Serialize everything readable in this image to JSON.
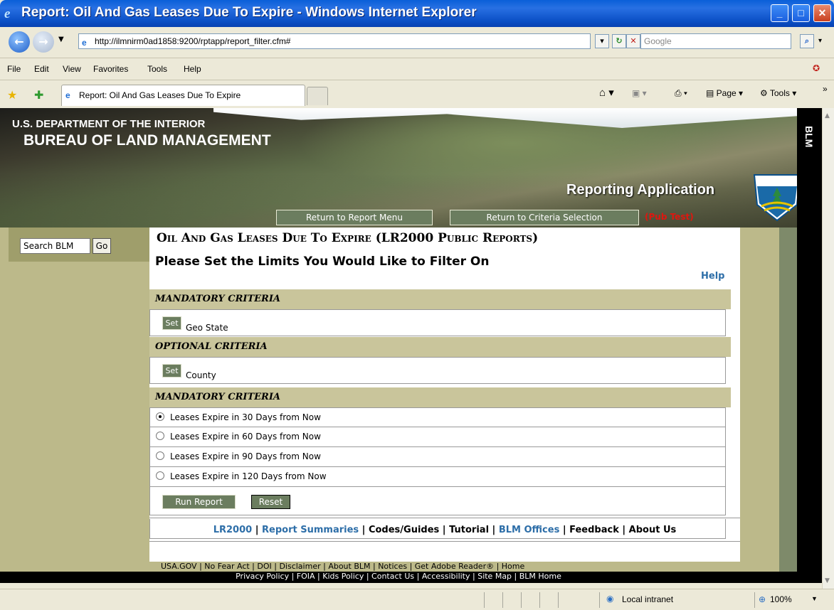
{
  "window": {
    "title": "Report: Oil And Gas Leases Due To Expire - Windows Internet Explorer",
    "address": "http://ilmnirm0ad1858:9200/rptapp/report_filter.cfm#",
    "search_placeholder": "Google"
  },
  "menu": [
    "File",
    "Edit",
    "View",
    "Favorites",
    "Tools",
    "Help"
  ],
  "tabbar": {
    "tab_label": "Report: Oil And Gas Leases Due To Expire",
    "page_label": "Page",
    "tools_label": "Tools"
  },
  "banner": {
    "dept": "U.S. DEPARTMENT OF THE INTERIOR",
    "bureau": "BUREAU OF LAND MANAGEMENT",
    "app": "Reporting Application",
    "side": "BLM",
    "nav_report_menu": "Return to Report Menu",
    "nav_criteria": "Return to Criteria Selection",
    "pub_test": "(Pub Test)"
  },
  "sidebar": {
    "search_value": "Search BLM",
    "go_label": "Go"
  },
  "report": {
    "title": "Oil And Gas Leases Due To Expire (LR2000 Public Reports)",
    "subtitle": "Please Set the Limits You Would Like to Filter On",
    "help": "Help",
    "section1": "MANDATORY CRITERIA",
    "set1_btn": "Set",
    "set1_label": "Geo State",
    "section2": "OPTIONAL CRITERIA",
    "set2_btn": "Set",
    "set2_label": "County",
    "section3": "MANDATORY CRITERIA",
    "options": [
      "Leases Expire in 30 Days from Now",
      "Leases Expire in 60 Days from Now",
      "Leases Expire in 90 Days from Now",
      "Leases Expire in 120 Days from Now"
    ],
    "selected_option": "Leases Expire in 30 Days from Now",
    "run_btn": "Run Report",
    "reset_btn": "Reset"
  },
  "footer_links": {
    "lr2000": "LR2000",
    "summaries": "Report Summaries",
    "codes": "Codes/Guides",
    "tutorial": "Tutorial",
    "offices": "BLM Offices",
    "feedback": "Feedback",
    "about": "About Us"
  },
  "bottom": {
    "line1": "USA.GOV  |  No Fear Act  |  DOI  |  Disclaimer  |  About BLM  |  Notices  |  Get Adobe Reader® | Home",
    "line2": "Privacy Policy  |  FOIA  |  Kids Policy  |  Contact Us  |  Accessibility  |  Site Map  |  BLM Home"
  },
  "status": {
    "zone": "Local intranet",
    "zoom": "100%"
  },
  "colors": {
    "olive": "#bcb98a",
    "section_header": "#c9c59b",
    "button_green": "#6b7d5f",
    "link_blue": "#2d6ea8",
    "pub_test_red": "#e0160f"
  }
}
